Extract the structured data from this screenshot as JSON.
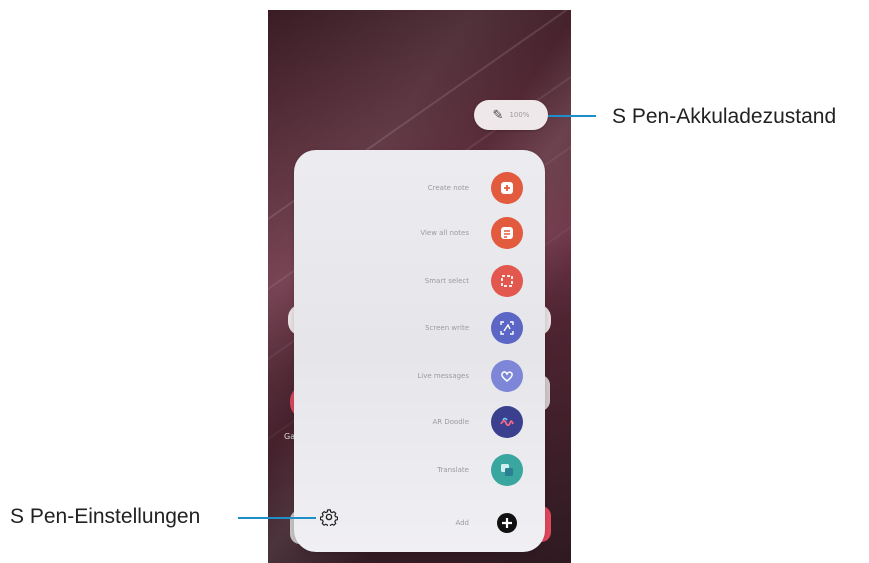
{
  "callouts": {
    "battery_label": "S Pen-Akkuladezustand",
    "settings_label": "S Pen-Einstellungen"
  },
  "battery": {
    "icon": "pen-icon",
    "percent": "100%"
  },
  "home": {
    "left_app_label": "Ga"
  },
  "menu": {
    "items": [
      {
        "label": "Create note",
        "icon": "create-note-icon",
        "color": "#e25b3f"
      },
      {
        "label": "View all notes",
        "icon": "view-notes-icon",
        "color": "#e25b3f"
      },
      {
        "label": "Smart select",
        "icon": "smart-select-icon",
        "color": "#e2574e"
      },
      {
        "label": "Screen write",
        "icon": "screen-write-icon",
        "color": "#5c66c4"
      },
      {
        "label": "Live messages",
        "icon": "live-messages-icon",
        "color": "#7e86d8"
      },
      {
        "label": "AR Doodle",
        "icon": "ar-doodle-icon",
        "color": "#3a3f8e"
      },
      {
        "label": "Translate",
        "icon": "translate-icon",
        "color": "#3aa6a0"
      },
      {
        "label": "Add",
        "icon": "add-icon",
        "color": "#111111"
      }
    ],
    "settings_icon": "gear-icon"
  },
  "colors": {
    "callout_line": "#1e8fc8"
  }
}
